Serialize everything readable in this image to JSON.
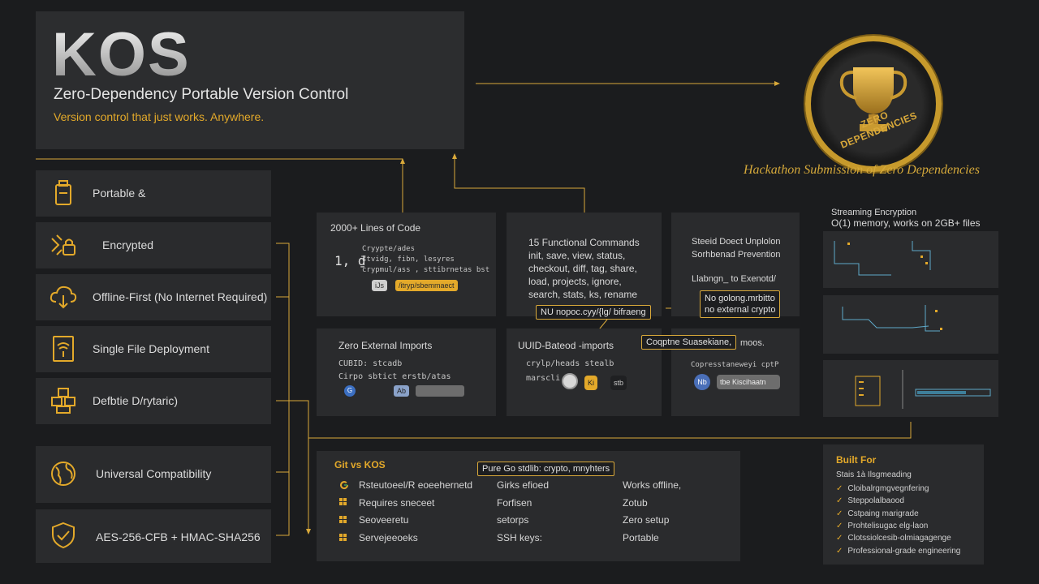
{
  "header": {
    "logo": "KOS",
    "subtitle": "Zero-Dependency Portable Version Control",
    "tagline": "Version control that just works. Anywhere."
  },
  "badge": {
    "text": "ZERO DEPENDENCIES",
    "caption": "Hackathon Submission of Zero Dependencies"
  },
  "features": [
    {
      "label": "Portable &",
      "icon": "usb-drive-icon"
    },
    {
      "label": "Encrypted",
      "icon": "lock-icon"
    },
    {
      "label": "Offline-First (No Internet Required)",
      "icon": "cloud-offline-icon"
    },
    {
      "label": "Single File Deployment",
      "icon": "document-wifi-icon"
    },
    {
      "label": "Defbtie D/rytaric)",
      "icon": "blocks-icon"
    },
    {
      "label": "Universal Compatibility",
      "icon": "globe-icon"
    },
    {
      "label": "AES-256-CFB + HMAC-SHA256",
      "icon": "shield-check-icon"
    }
  ],
  "cards": {
    "lines_of_code": {
      "title": "2000+ Lines of Code",
      "code": [
        "Cryypte/ades",
        "stvidg, fibn, lesyres",
        "crypmul/ass , sttibrnetas bst"
      ],
      "pills": [
        "iJs",
        "/itryp/sbemmaect"
      ]
    },
    "commands": {
      "title": "15 Functional Commands",
      "list": [
        "init, save, view, status,",
        "checkout, diff, tag, share,",
        "load, projects, ignore,",
        "search, stats, ks, rename"
      ]
    },
    "prevention": {
      "lines": [
        "Steeid Doect Unplolon",
        "Sorhbenad Prevention",
        "Llabngn_ to Exenotd/"
      ]
    },
    "imports": {
      "title": "Zero External Imports",
      "code": [
        "CUBID: stcadb",
        "Cirpo sbtict   erstb/atas"
      ],
      "pills": [
        "G",
        "Ab"
      ]
    },
    "uuid": {
      "title": "UUID-Bateod -imports",
      "code": [
        "crylp/heads stealb",
        "marscli"
      ],
      "pills": [
        "Ki",
        "stb"
      ]
    },
    "compute": {
      "code": "Copresstaneweyi cptP",
      "pills": [
        "Nb",
        "tbe Kiscihaatn"
      ]
    }
  },
  "callouts": {
    "no_golang": [
      "No golong.mrbitto",
      "no external crypto"
    ],
    "lib": "NU nopoc.cyy/{lg/ bifraeng",
    "compress": "Coqptne Suasekiane,",
    "compress_suffix": "moos.",
    "pure_go": "Pure Go stdlib: crypto, mnyhters"
  },
  "graphs": {
    "title": "Streaming Encryption",
    "subtitle": "O(1) memory, works on 2GB+ files"
  },
  "compare": {
    "title": "Git vs KOS",
    "rows": [
      [
        "Rsteutoeel/R eoeehernetd",
        "Girks efioed",
        "Works offline,"
      ],
      [
        "Requires sneceet",
        "Forfisen",
        "Zotub"
      ],
      [
        "Seoveeretu",
        "setorps",
        "Zero setup"
      ],
      [
        "Servejeeoeks",
        "SSH keys:",
        "Portable"
      ]
    ]
  },
  "built_for": {
    "title": "Built For",
    "lead": "Stais 1à  Ilsgmeading",
    "items": [
      "Cloibalrgmgvegnfering",
      "Steppolalbaood",
      "Cstpaing marigrade",
      "Prohtelisugac elg-laon",
      "Clotssiolcesib-olmiagagenge",
      "Professional-grade engineering"
    ]
  },
  "colors": {
    "accent": "#e3a92a",
    "panel": "#2a2b2d",
    "background": "#1b1c1e"
  }
}
